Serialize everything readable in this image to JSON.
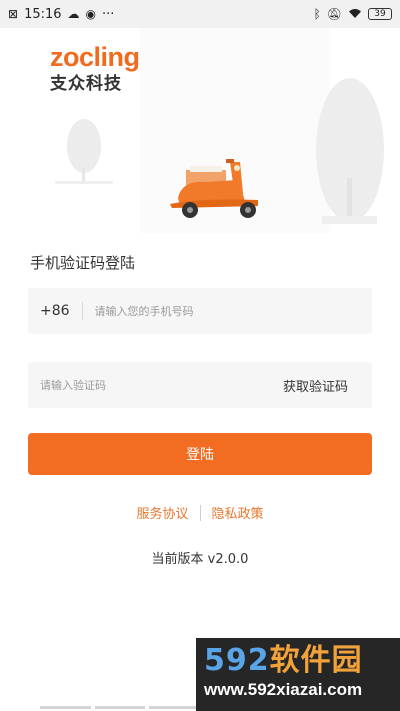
{
  "status_bar": {
    "time": "15:16",
    "battery": "39",
    "dots": "···"
  },
  "logo": {
    "brand": "zocling",
    "brand_cn": "支众科技"
  },
  "form": {
    "title": "手机验证码登陆",
    "phone_prefix": "+86",
    "phone_placeholder": "请输入您的手机号码",
    "code_placeholder": "请输入验证码",
    "get_code_label": "获取验证码",
    "login_label": "登陆"
  },
  "links": {
    "service": "服务协议",
    "privacy": "隐私政策"
  },
  "version_text": "当前版本 v2.0.0",
  "watermark": {
    "number": "592",
    "cn": "软件园",
    "url": "www.592xiazai.com"
  },
  "colors": {
    "accent": "#f26d22",
    "link": "#e8772e",
    "brand": "#f06b1d"
  }
}
